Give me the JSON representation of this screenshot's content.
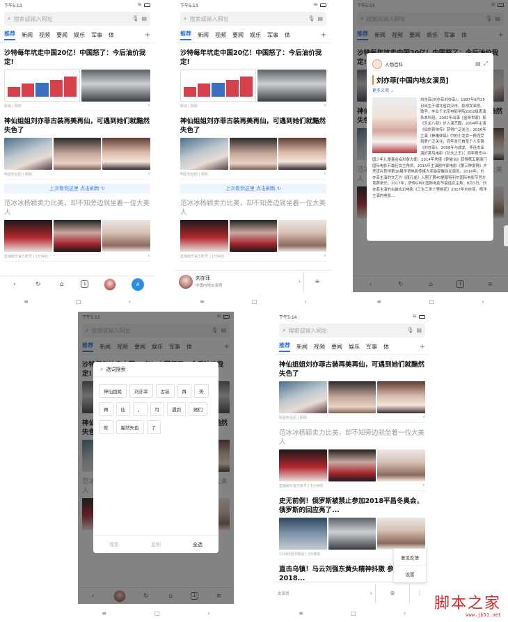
{
  "status": {
    "time_1": "下午5:13",
    "time_5": "下午5:14"
  },
  "search": {
    "placeholder": "搜索或输入网址"
  },
  "tabs": [
    "推荐",
    "新闻",
    "视频",
    "要闻",
    "娱乐",
    "军事",
    "体"
  ],
  "articles": [
    {
      "title": "沙特每年坑走中国20亿！中国怒了：今后油价我定!",
      "source": "新浪 | 刚刚"
    },
    {
      "title": "神仙姐姐刘亦菲古装再美再仙，可遇到她们就黯然失色了",
      "source": "明星粉丝团 | 刚刚"
    },
    {
      "title": "范冰冰杨颖卖力比美，却不知旁边就坐着一位大美人",
      "source": "直播娱乐官方账号 | 1分钟前"
    },
    {
      "title": "史无前例！俄罗斯被禁止参加2018平昌冬奥会，俄罗斯的回应亮了...",
      "source": "21世纪经济报道 | 2分钟前"
    },
    {
      "title": "直击乌镇！马云刘强东黄头精神抖擞 参加2018...",
      "source": ""
    }
  ],
  "refresh": {
    "label": "上次看到这里 点击刷新"
  },
  "bottombar": {
    "tab_count": "1",
    "assist_label": "A"
  },
  "baike": {
    "source": "人物百科",
    "name": "刘亦菲",
    "subtitle": "中国内地女演员",
    "title": "刘亦菲[中国内地女演员]",
    "more": "更多义项",
    "body": "刘亦菲(刘亦菲刘亦菲)，1987年8月25日出生于湖北省武汉市，影视女演员、歌手，毕业于北京电影学院2002级表演系本科班。2002年出演《金粉世家》和《天龙八部》步入演艺圈，2004年主演《仙剑奇侠传》获得广泛关注，2006年主演《神雕侠侣》中的小龙女一角而受到更广泛关注，同年发行首张个人专辑《刘亦菲》。2008年与成龙、李连杰出演好莱坞电影《功夫之王》；同年担任中国少年儿童基金会形象大使。2014年凭借《铜雀台》获得第五届澳门国际电影节最佳女主角奖。2015年主演剧作家电影《第三种爱情》并凭该片获得第16届华语电影传媒大奖最受瞩目女演员。2016年，刘亦菲主演的文艺片《夜孔雀》入围了第40届蒙特利尔国际电影节官方竞赛单元。2017年，获得GMIC国际电影节最佳女主角；8月3日，刘亦菲主演的古装玄幻电影《三生三世十里桃花》2017年刘亦菲，杨洋主演的电影...",
    "footer": "打开百度百科"
  },
  "word_select": {
    "title": "选词搜索",
    "chips": [
      "神仙姐姐",
      "刘亦菲",
      "古装",
      "再",
      "美",
      "再",
      "仙",
      "，",
      "可",
      "遇到",
      "她们",
      "就",
      "黯然失色",
      "了"
    ],
    "btn_search": "搜索",
    "btn_copy": "复制",
    "btn_all": "全选"
  },
  "menu": {
    "feedback": "意见反馈",
    "settings": "设置"
  },
  "strip5": {
    "label": "女演员"
  },
  "watermark": {
    "cn": "脚本之家",
    "url": "www.jb51.net"
  },
  "colors": {
    "accent": "#2f73d9",
    "refresh_bg": "#eef4fd",
    "watermark": "#d62a2a"
  }
}
